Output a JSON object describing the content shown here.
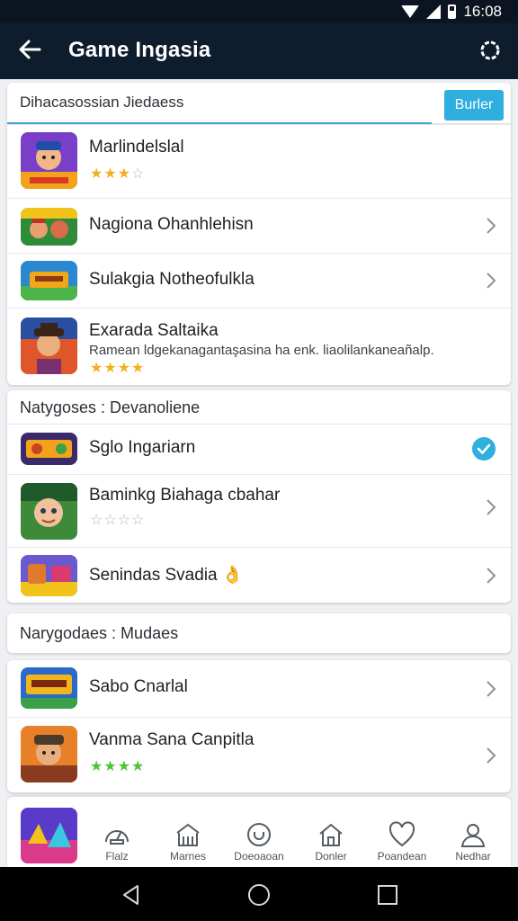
{
  "status_bar": {
    "time": "16:08"
  },
  "app_bar": {
    "title": "Game Ingasia"
  },
  "search": {
    "value": "Dihacasossian Jiedaess",
    "button_label": "Burler"
  },
  "games_top": [
    {
      "title": "Marlindelslal",
      "rating": 3,
      "star_color": "gold"
    },
    {
      "title": "Nagiona Ohanhlehisn"
    },
    {
      "title": "Sulakgia Notheofulkla"
    },
    {
      "title": "Exarada Saltaika",
      "description": "Ramean ldgekanagantaşasina ha enk. liaolilankaneañalp.",
      "rating": 4,
      "star_color": "gold"
    }
  ],
  "section_one": {
    "title": "Natygoses : Devanoliene",
    "items": [
      {
        "title": "Sglo Ingariarn",
        "selected": true
      },
      {
        "title": "Baminkg Biahaga cbahar",
        "rating": 0
      },
      {
        "title": "Senindas Svadia",
        "emoji": "👌"
      }
    ]
  },
  "section_two": {
    "title": "Narygodaes : Mudaes",
    "items": [
      {
        "title": "Sabo Cnarlal"
      },
      {
        "title": "Vanma Sana Canpitla",
        "rating": 4,
        "star_color": "green"
      }
    ]
  },
  "bottom_nav": [
    {
      "label": "Flalz",
      "icon": "speedometer-icon"
    },
    {
      "label": "Marnes",
      "icon": "building-icon"
    },
    {
      "label": "Doeoaoan",
      "icon": "clock-icon"
    },
    {
      "label": "Donler",
      "icon": "home-icon"
    },
    {
      "label": "Poandean",
      "icon": "heart-icon"
    },
    {
      "label": "Nedhar",
      "icon": "person-icon"
    }
  ],
  "colors": {
    "app_bar": "#0d1d2e",
    "accent": "#2faee0",
    "star_gold": "#f2b01e",
    "star_green": "#4cc437"
  }
}
